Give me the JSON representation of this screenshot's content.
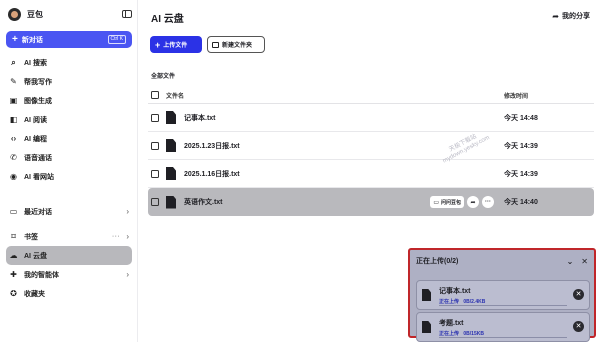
{
  "user": {
    "name": "豆包"
  },
  "sidebar": {
    "new_chat": {
      "label": "新对话",
      "shortcut": "Ctrl K"
    },
    "items": [
      {
        "label": "AI 搜索",
        "icon": "search-icon"
      },
      {
        "label": "帮我写作",
        "icon": "pen-icon"
      },
      {
        "label": "图像生成",
        "icon": "image-icon"
      },
      {
        "label": "AI 阅读",
        "icon": "book-icon"
      },
      {
        "label": "AI 编程",
        "icon": "code-icon"
      },
      {
        "label": "语音通话",
        "icon": "phone-icon"
      },
      {
        "label": "AI 看网站",
        "icon": "globe-icon"
      }
    ],
    "recent": {
      "label": "最近对话"
    },
    "bookmarks": {
      "label": "书签"
    },
    "cloud": {
      "label": "AI 云盘"
    },
    "agents": {
      "label": "我的智能体"
    },
    "favorites": {
      "label": "收藏夹"
    }
  },
  "main": {
    "title": "AI 云盘",
    "share_label": "我的分享",
    "upload_label": "上传文件",
    "new_folder_label": "新建文件夹",
    "all_files_label": "全部文件",
    "col_name": "文件名",
    "col_time": "修改时间",
    "files": [
      {
        "name": "记事本.txt",
        "time": "今天 14:48"
      },
      {
        "name": "2025.1.23日报.txt",
        "time": "今天 14:39"
      },
      {
        "name": "2025.1.16日报.txt",
        "time": "今天 14:39"
      },
      {
        "name": "英语作文.txt",
        "time": "今天 14:40"
      }
    ],
    "row_action_label": "问问豆包",
    "watermark": "天极下载站\nmydown.yesky.com"
  },
  "upload": {
    "title": "正在上传(0/2)",
    "items": [
      {
        "name": "记事本.txt",
        "status": "正在上传",
        "size": "0B/2.4KB"
      },
      {
        "name": "考题.txt",
        "status": "正在上传",
        "size": "0B/15KB"
      }
    ]
  }
}
